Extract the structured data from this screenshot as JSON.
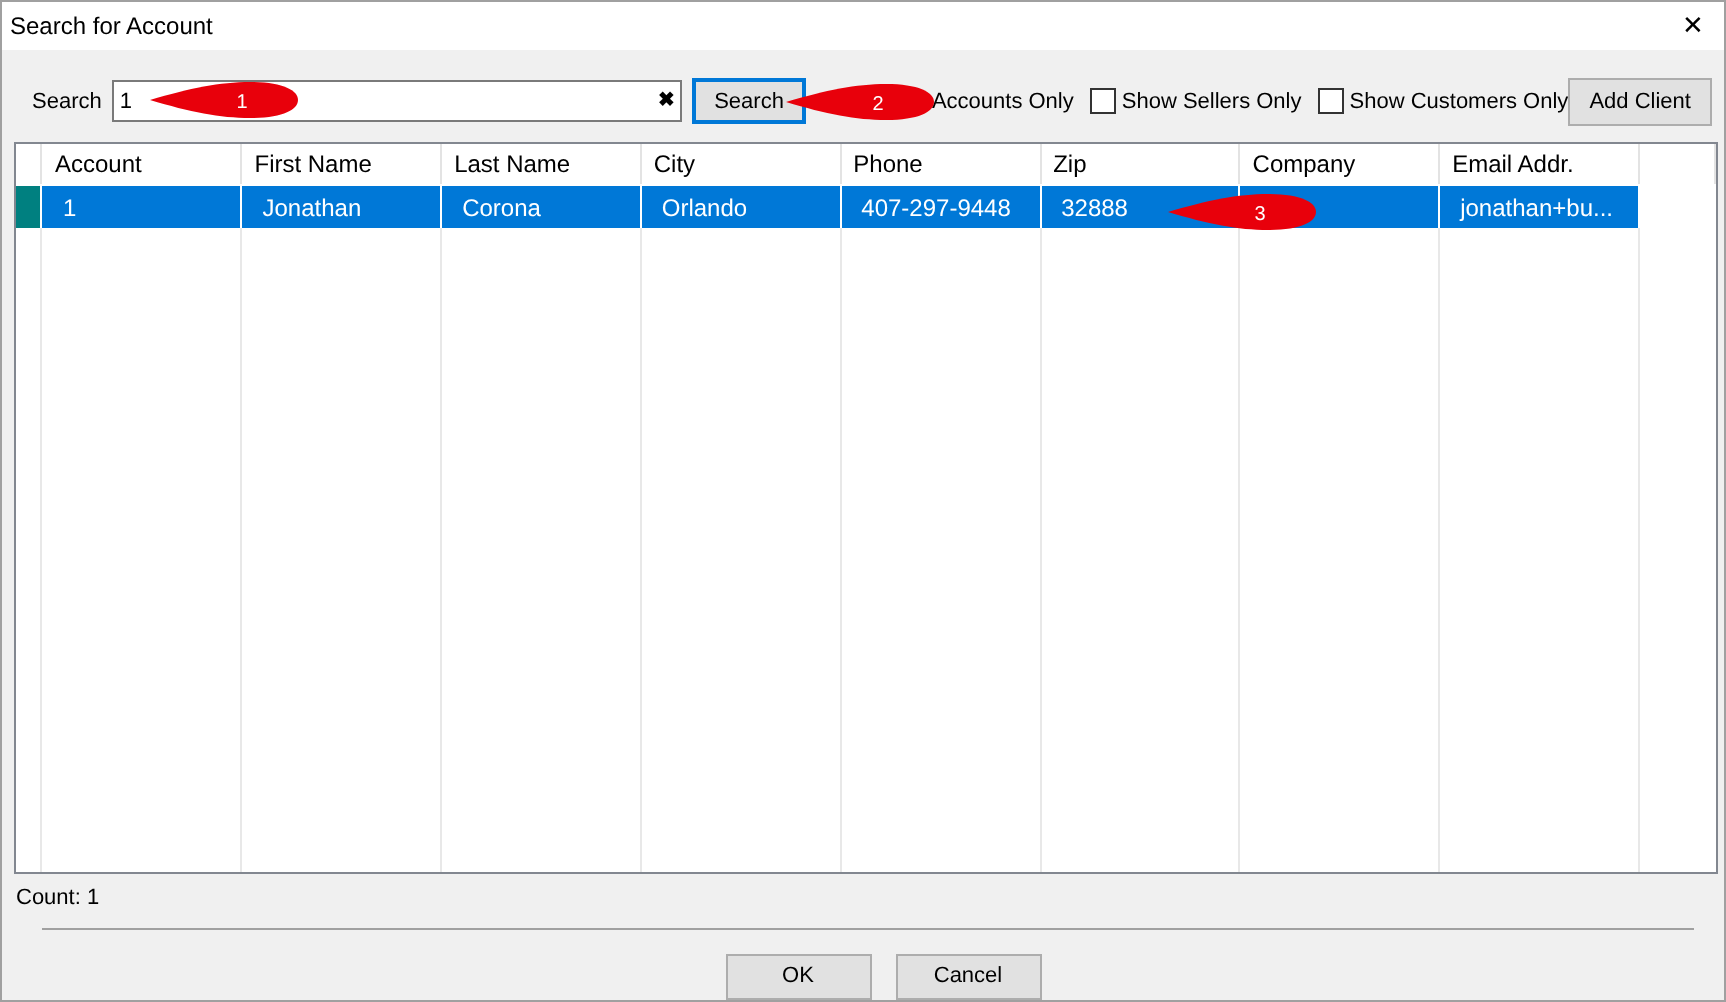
{
  "window": {
    "title": "Search for Account",
    "close": "✕"
  },
  "search": {
    "label": "Search",
    "value": "1",
    "clear": "✖",
    "button": "Search"
  },
  "filters": [
    {
      "label": "Accounts Only"
    },
    {
      "label": "Show Sellers Only",
      "checked": false
    },
    {
      "label": "Show Customers Only",
      "checked": false
    }
  ],
  "add_button": "Add Client",
  "table": {
    "columns": [
      "Account",
      "First Name",
      "Last Name",
      "City",
      "Phone",
      "Zip",
      "Company",
      "Email Addr."
    ],
    "rows": [
      {
        "selected": true,
        "cells": [
          "1",
          "Jonathan",
          "Corona",
          "Orlando",
          "407-297-9448",
          "32888",
          "",
          "jonathan+bu..."
        ]
      }
    ]
  },
  "count": "Count: 1",
  "buttons": [
    "OK",
    "Cancel"
  ],
  "callouts": [
    "1",
    "2",
    "3"
  ]
}
